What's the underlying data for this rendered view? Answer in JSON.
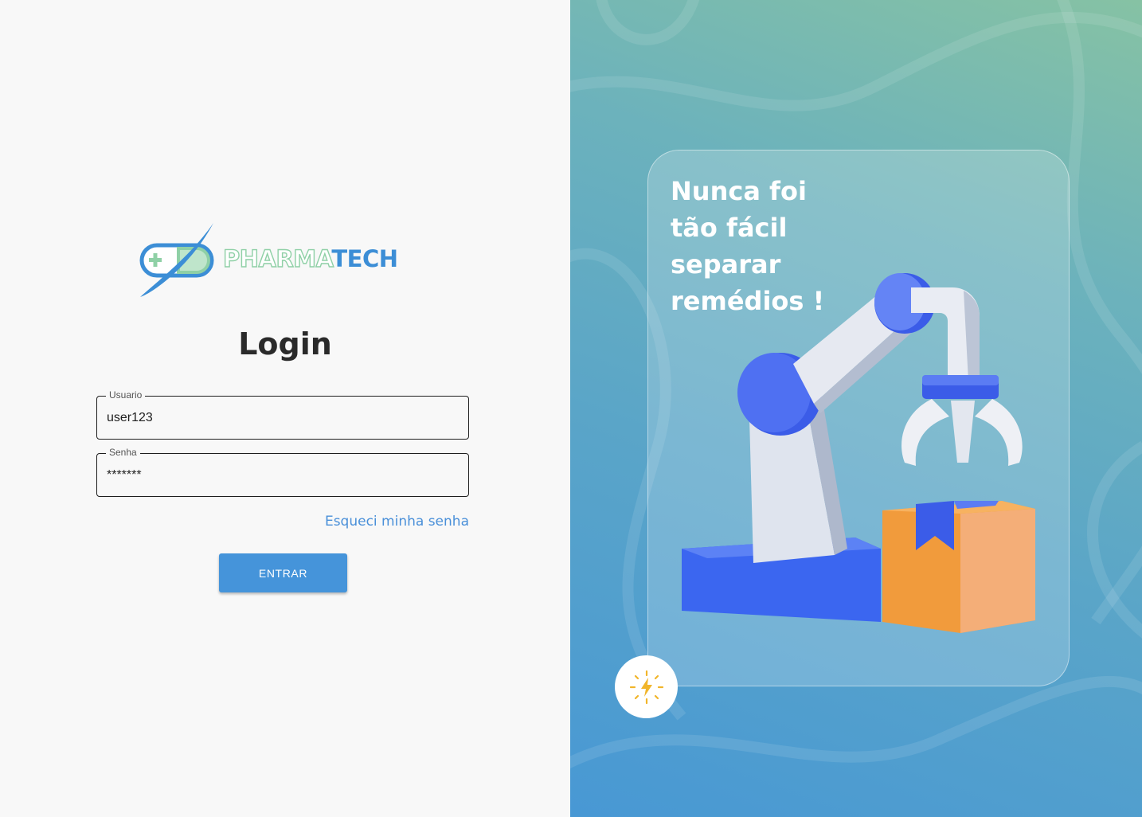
{
  "brand": {
    "name_part1": "PHARMA",
    "name_part2": "TECH",
    "logo_icon": "capsule-orbit-logo-icon"
  },
  "login": {
    "title": "Login",
    "username": {
      "label": "Usuario",
      "value": "user123"
    },
    "password": {
      "label": "Senha",
      "value": "*******"
    },
    "forgot_password": "Esqueci minha senha",
    "submit_label": "ENTRAR"
  },
  "promo": {
    "headline_lines": [
      "Nunca foi",
      "tão fácil",
      "separar",
      "remédios !"
    ],
    "illustration": "robot-arm-with-box",
    "badge_icon": "lightning-spark-icon"
  },
  "colors": {
    "accent": "#4594da",
    "brand_green": "#8fd0a6",
    "brand_blue": "#3c8ed6",
    "text_dark": "#2a2a2a",
    "panel_gradient": [
      "#86c2a4",
      "#4898d4"
    ]
  }
}
